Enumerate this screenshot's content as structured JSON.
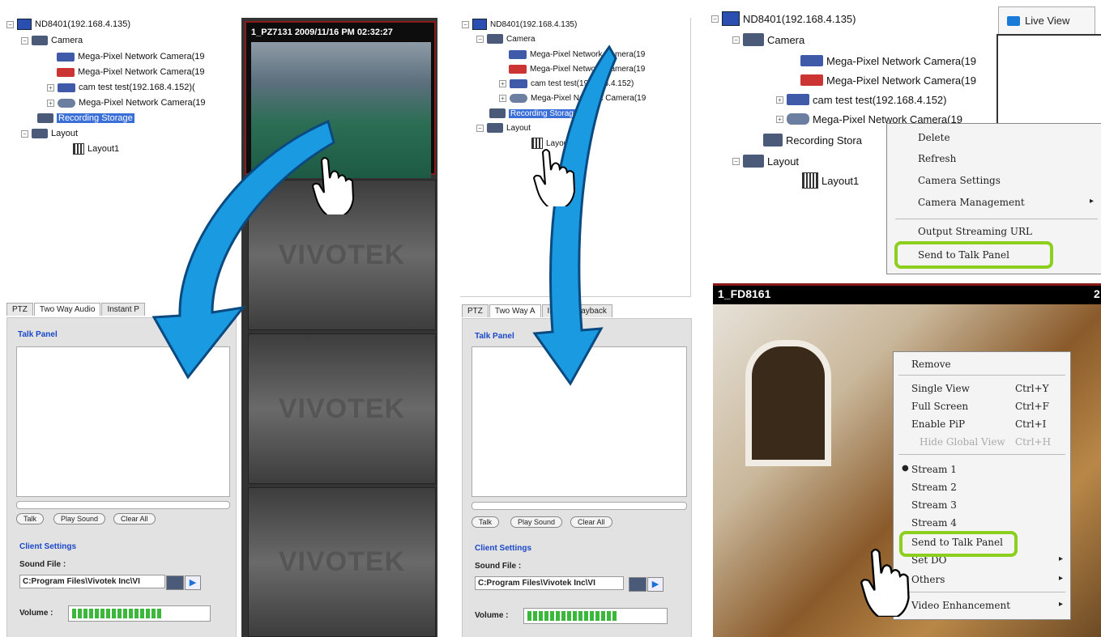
{
  "tree": {
    "server": "ND8401(192.168.4.135)",
    "camera_group": "Camera",
    "cameras": [
      "Mega-Pixel Network Camera(19",
      "Mega-Pixel Network Camera(19",
      "cam test test(192.168.4.152)",
      "Mega-Pixel Network Camera(19"
    ],
    "recording": "Recording Storage",
    "layout_group": "Layout",
    "layout1": "Layout1"
  },
  "left": {
    "cam3_trunc": "cam test test(192.168.4.152)(",
    "video_overlay": "1_PZ7131 2009/11/16 PM 02:32:27",
    "tabs": [
      "PTZ",
      "Two Way Audio",
      "Instant P"
    ]
  },
  "middle": {
    "cameras": [
      "Mega-Pixel Network Camera(19",
      "Mega-Pixel Network Camera(19",
      "cam test test(192.168.4.152)",
      "Mega-Pixel Network Camera(19"
    ],
    "tabs": [
      "PTZ",
      "Two Way A",
      "Instant Playback"
    ]
  },
  "talk": {
    "title": "Talk Panel",
    "btn_talk": "Talk",
    "btn_play": "Play Sound",
    "btn_clear": "Clear All",
    "client_settings": "Client Settings",
    "sound_file_label": "Sound File :",
    "sound_file_value": "C:Program Files\\Vivotek Inc\\VI",
    "volume_label": "Volume :"
  },
  "brand": "VIVOTEK",
  "right_top": {
    "live_view_tab": "Live View",
    "recording_trunc": "Recording Stora",
    "camera_dome_trunc": "Mega-Pixel Network Camera(19",
    "context_menu": [
      "Delete",
      "Refresh",
      "Camera Settings",
      "Camera Management",
      "Output Streaming URL",
      "Send to Talk Panel"
    ]
  },
  "right_bottom": {
    "camera_label": "1_FD8161",
    "camera_label_suffix": "2",
    "menu": {
      "remove": "Remove",
      "single_view": "Single View",
      "single_view_key": "Ctrl+Y",
      "full_screen": "Full Screen",
      "full_screen_key": "Ctrl+F",
      "enable_pip": "Enable PiP",
      "enable_pip_key": "Ctrl+I",
      "hide_global": "Hide Global View",
      "hide_global_key": "Ctrl+H",
      "streams": [
        "Stream 1",
        "Stream 2",
        "Stream 3",
        "Stream 4"
      ],
      "send_talk": "Send to Talk Panel",
      "set_do": "Set DO",
      "others": "Others",
      "video_enh": "Video Enhancement"
    }
  },
  "colors": {
    "arrow": "#1a9ae0",
    "highlight": "#8ccf1e",
    "selection": "#3a6fd8"
  }
}
